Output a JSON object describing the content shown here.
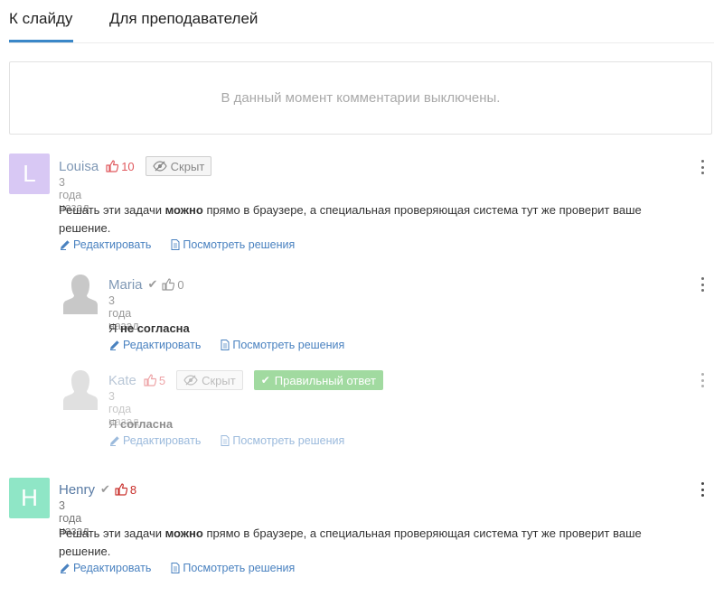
{
  "tabs": [
    {
      "label": "К слайду",
      "active": true
    },
    {
      "label": "Для преподавателей",
      "active": false
    }
  ],
  "notice": "В данный момент комментарии выключены.",
  "colors": {
    "accent": "#3a87c8",
    "link": "#4a82c0",
    "like_red": "#e0595e",
    "correct_green": "#a8dea6",
    "avatar_louisa": "#d8c8f4",
    "avatar_henry": "#8fe6c6"
  },
  "comments": [
    {
      "avatar_letter": "L",
      "author": "Louisa",
      "likes": "10",
      "hidden_badge": "Скрыт",
      "time": "3 года назад",
      "text_before": "Решать эти задачи ",
      "text_bold": "можно",
      "text_after": " прямо в браузере, а специальная проверяющая система тут же проверит ваше решение.",
      "edit": "Редактировать",
      "view": "Посмотреть решения"
    },
    {
      "author": "Maria",
      "likes": "0",
      "time": "3 года назад",
      "text_before": "Я ",
      "text_bold": "не согласна",
      "edit": "Редактировать",
      "view": "Посмотреть решения"
    },
    {
      "author": "Kate",
      "likes": "5",
      "hidden_badge": "Скрыт",
      "correct_badge": "Правильный ответ",
      "time": "3 года назад",
      "text_before": "Я ",
      "text_bold": "согласна",
      "edit": "Редактировать",
      "view": "Посмотреть решения"
    },
    {
      "avatar_letter": "H",
      "author": "Henry",
      "likes": "8",
      "time": "3 года назад",
      "text_before": "Решать эти задачи ",
      "text_bold": "можно",
      "text_after": " прямо в браузере, а специальная проверяющая система тут же проверит ваше решение.",
      "edit": "Редактировать",
      "view": "Посмотреть решения"
    }
  ]
}
